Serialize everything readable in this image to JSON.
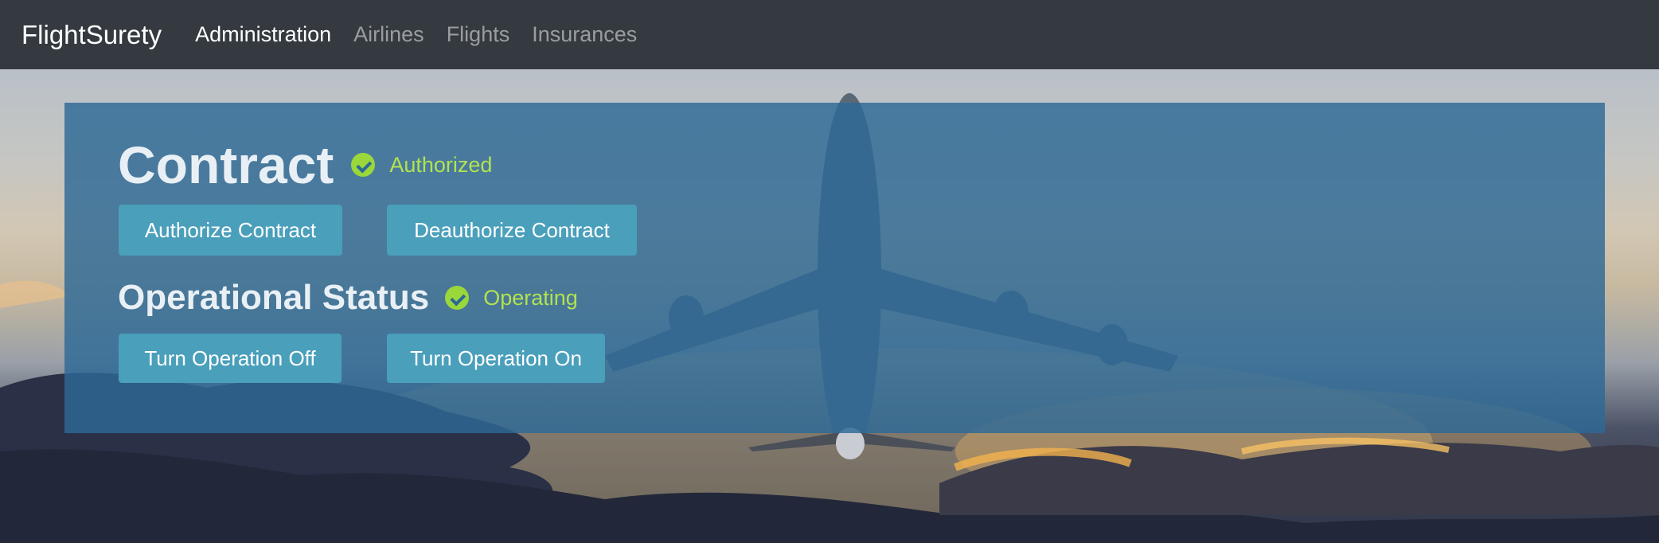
{
  "navbar": {
    "brand": "FlightSurety",
    "links": [
      {
        "label": "Administration",
        "active": true
      },
      {
        "label": "Airlines",
        "active": false
      },
      {
        "label": "Flights",
        "active": false
      },
      {
        "label": "Insurances",
        "active": false
      }
    ]
  },
  "contract": {
    "title": "Contract",
    "status": "Authorized",
    "status_icon": "check-circle-icon",
    "authorize_label": "Authorize Contract",
    "deauthorize_label": "Deauthorize Contract"
  },
  "operational": {
    "title": "Operational Status",
    "status": "Operating",
    "status_icon": "check-circle-icon",
    "turn_off_label": "Turn Operation Off",
    "turn_on_label": "Turn Operation On"
  },
  "colors": {
    "navbar": "#343a40",
    "panel": "#2d6996",
    "button": "#4a9fbb",
    "status": "#9ad73b"
  }
}
